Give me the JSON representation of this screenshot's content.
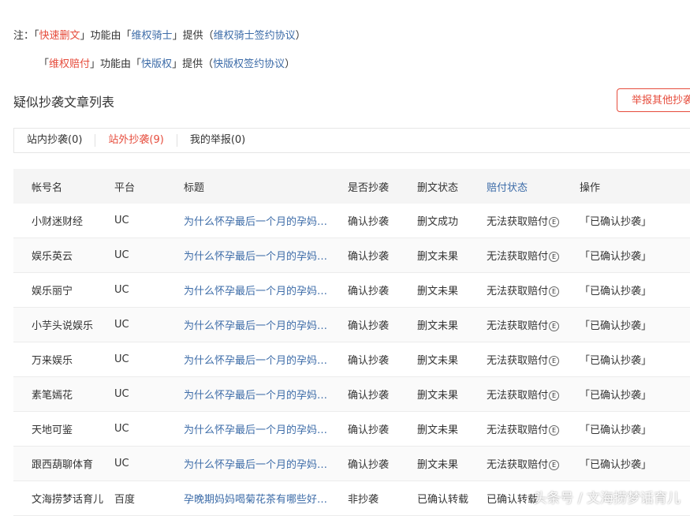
{
  "notes": {
    "line1": {
      "prefix": "注：「",
      "feature": "快速删文",
      "mid": "」功能由「",
      "provider": "维权骑士",
      "suffix": "」提供（",
      "agreement": "维权骑士签约协议",
      "end": "）"
    },
    "line2": {
      "prefix": "「",
      "feature": "维权赔付",
      "mid": "」功能由「",
      "provider": "快版权",
      "suffix": "」提供（",
      "agreement": "快版权签约协议",
      "end": "）"
    }
  },
  "list_title": "疑似抄袭文章列表",
  "report_button": "举报其他抄袭",
  "tabs": [
    {
      "label": "站内抄袭(0)",
      "active": false
    },
    {
      "label": "站外抄袭(9)",
      "active": true
    },
    {
      "label": "我的举报(0)",
      "active": false
    }
  ],
  "table": {
    "headers": [
      "帐号名",
      "平台",
      "标题",
      "是否抄袭",
      "删文状态",
      "赔付状态",
      "操作"
    ],
    "rows": [
      {
        "account": "小财迷财经",
        "platform": "UC",
        "title": "为什么怀孕最后一个月的孕妈…",
        "plagiarism": "确认抄袭",
        "delete_status": "删文成功",
        "pay_status": "无法获取赔付",
        "action": "「已确认抄袭」"
      },
      {
        "account": "娱乐英云",
        "platform": "UC",
        "title": "为什么怀孕最后一个月的孕妈…",
        "plagiarism": "确认抄袭",
        "delete_status": "删文未果",
        "pay_status": "无法获取赔付",
        "action": "「已确认抄袭」"
      },
      {
        "account": "娱乐丽宁",
        "platform": "UC",
        "title": "为什么怀孕最后一个月的孕妈…",
        "plagiarism": "确认抄袭",
        "delete_status": "删文未果",
        "pay_status": "无法获取赔付",
        "action": "「已确认抄袭」"
      },
      {
        "account": "小芋头说娱乐",
        "platform": "UC",
        "title": "为什么怀孕最后一个月的孕妈…",
        "plagiarism": "确认抄袭",
        "delete_status": "删文未果",
        "pay_status": "无法获取赔付",
        "action": "「已确认抄袭」"
      },
      {
        "account": "万来娱乐",
        "platform": "UC",
        "title": "为什么怀孕最后一个月的孕妈…",
        "plagiarism": "确认抄袭",
        "delete_status": "删文未果",
        "pay_status": "无法获取赔付",
        "action": "「已确认抄袭」"
      },
      {
        "account": "素笔嫣花",
        "platform": "UC",
        "title": "为什么怀孕最后一个月的孕妈…",
        "plagiarism": "确认抄袭",
        "delete_status": "删文未果",
        "pay_status": "无法获取赔付",
        "action": "「已确认抄袭」"
      },
      {
        "account": "天地可鉴",
        "platform": "UC",
        "title": "为什么怀孕最后一个月的孕妈…",
        "plagiarism": "确认抄袭",
        "delete_status": "删文未果",
        "pay_status": "无法获取赔付",
        "action": "「已确认抄袭」"
      },
      {
        "account": "跟西葫聊体育",
        "platform": "UC",
        "title": "为什么怀孕最后一个月的孕妈…",
        "plagiarism": "确认抄袭",
        "delete_status": "删文未果",
        "pay_status": "无法获取赔付",
        "action": "「已确认抄袭」"
      },
      {
        "account": "文海捞梦话育儿",
        "platform": "百度",
        "title": "孕晚期妈妈喝菊花茶有哪些好…",
        "plagiarism": "非抄袭",
        "delete_status": "已确认转载",
        "pay_status": "已确认转载",
        "action": ""
      }
    ]
  },
  "circle_e_glyph": "E",
  "watermark": "头条号 / 文海捞梦话育儿",
  "colors": {
    "accent_red": "#e64c3c",
    "link_blue": "#3d6ca8"
  }
}
